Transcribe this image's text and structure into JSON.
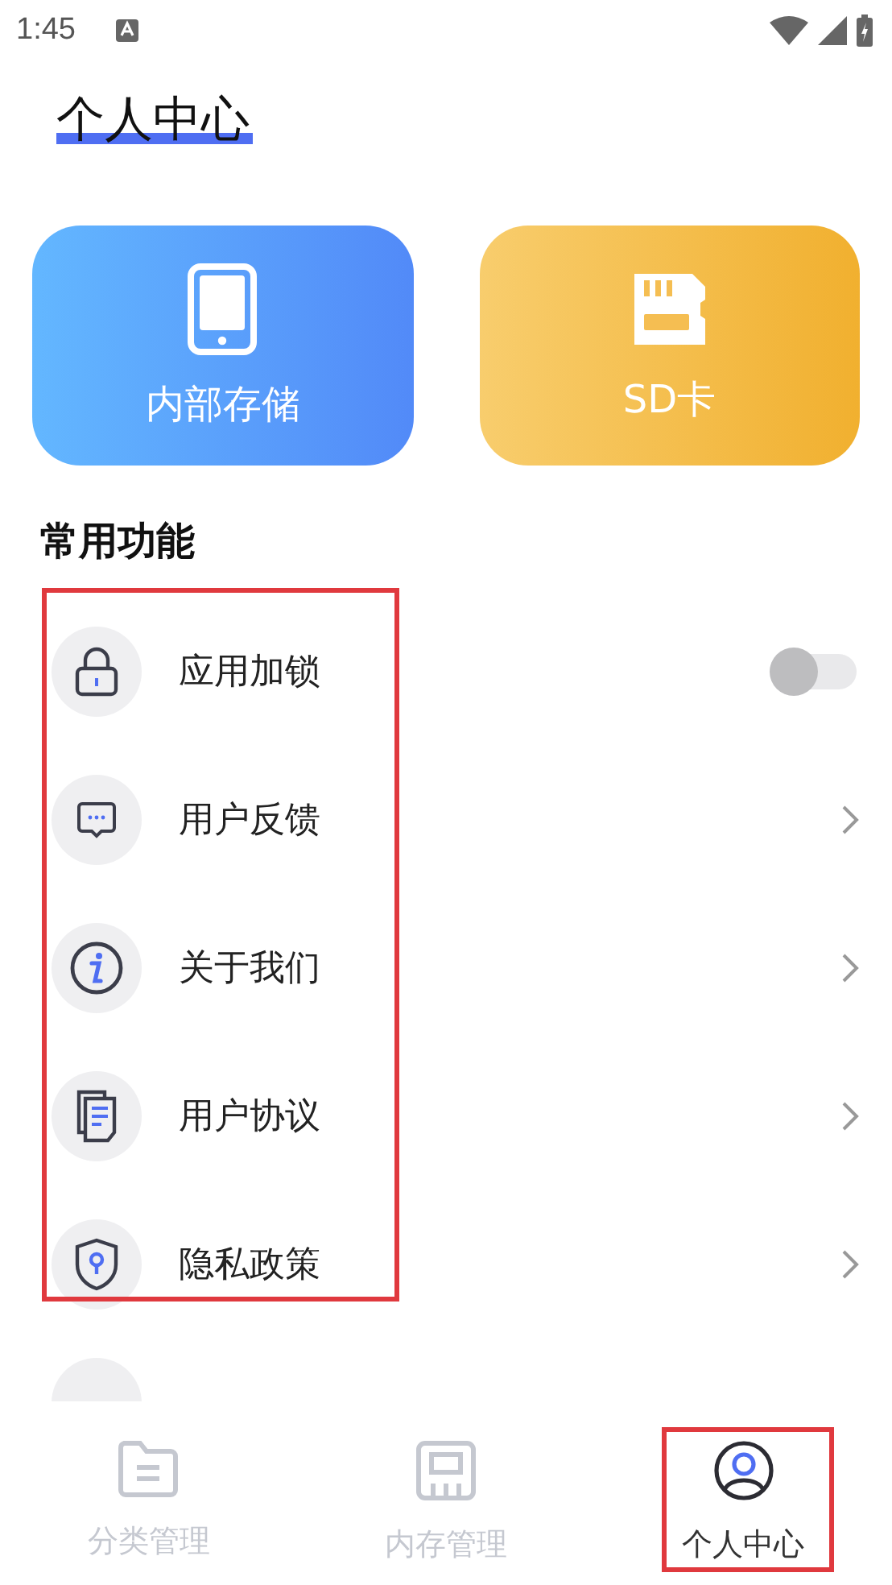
{
  "status_bar": {
    "time": "1:45"
  },
  "page_title": "个人中心",
  "storage_cards": [
    {
      "kind": "internal",
      "label": "内部存储"
    },
    {
      "kind": "sd",
      "label": "SD卡"
    }
  ],
  "section_title": "常用功能",
  "menu": [
    {
      "kind": "toggle",
      "label": "应用加锁",
      "on": false
    },
    {
      "kind": "link",
      "label": "用户反馈"
    },
    {
      "kind": "link",
      "label": "关于我们"
    },
    {
      "kind": "link",
      "label": "用户协议"
    },
    {
      "kind": "link",
      "label": "隐私政策"
    }
  ],
  "bottom_nav": [
    {
      "label": "分类管理",
      "selected": false
    },
    {
      "label": "内存管理",
      "selected": false
    },
    {
      "label": "个人中心",
      "selected": true
    }
  ]
}
